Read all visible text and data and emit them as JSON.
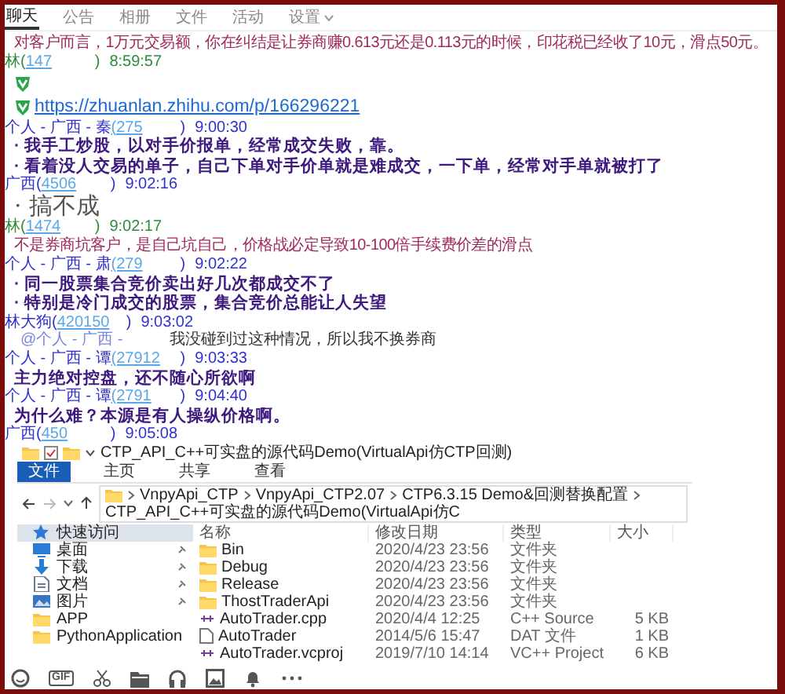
{
  "tabs": [
    {
      "label": "聊天",
      "selected": true,
      "dropdown": false
    },
    {
      "label": "公告",
      "selected": false,
      "dropdown": false
    },
    {
      "label": "相册",
      "selected": false,
      "dropdown": false
    },
    {
      "label": "文件",
      "selected": false,
      "dropdown": false
    },
    {
      "label": "活动",
      "selected": false,
      "dropdown": false
    },
    {
      "label": "设置",
      "selected": false,
      "dropdown": true
    }
  ],
  "messages": [
    {
      "kind": "quote",
      "text": "对客户而言，1万元交易额，你在纠结是让券商赚0.613元还是0.113元的时候，印花税已经收了10元，滑点50元。"
    },
    {
      "kind": "sender",
      "prefix": "林(",
      "id": "147",
      "suffix": ")",
      "time": "8:59:57",
      "color": "#2e8b3a"
    },
    {
      "kind": "badge"
    },
    {
      "kind": "link",
      "url": "https://zhuanlan.zhihu.com/p/166296221"
    },
    {
      "kind": "sender",
      "prefix": "个人 - 广西 - 秦",
      "id": "(275",
      "suffix": ")",
      "time": "9:00:30",
      "color": "#3030d0"
    },
    {
      "kind": "text",
      "text": "· 我手工炒股，以对手价报单，经常成交失败，靠。"
    },
    {
      "kind": "text",
      "text": "· 看着没人交易的单子，自己下单对手价单就是难成交，一下单，经常对手单就被打了"
    },
    {
      "kind": "sender",
      "prefix": "广西(",
      "id": "4506",
      "suffix": ")",
      "time": "9:02:16",
      "color": "#3030d0"
    },
    {
      "kind": "sticker",
      "text": "· 搞不成"
    },
    {
      "kind": "sender",
      "prefix": "林(",
      "id": "1474",
      "suffix": ")",
      "time": "9:02:17",
      "color": "#2e8b3a"
    },
    {
      "kind": "quote",
      "text": "不是券商坑客户，是自己坑自己，价格战必定导致10-100倍手续费价差的滑点"
    },
    {
      "kind": "sender",
      "prefix": "个人 - 广西 - 肃",
      "id": "(279",
      "suffix": ")",
      "time": "9:02:22",
      "color": "#3030d0"
    },
    {
      "kind": "text",
      "text": "· 同一股票集合竞价卖出好几次都成交不了"
    },
    {
      "kind": "text",
      "text": "· 特别是冷门成交的股票，集合竞价总能让人失望"
    },
    {
      "kind": "sender",
      "prefix": "林大狗(",
      "id": "420150",
      "suffix": ")",
      "time": "9:03:02",
      "color": "#3030d0"
    },
    {
      "kind": "mention",
      "mention": "@个人 - 广西 -",
      "text": "我没碰到过这种情况，所以我不换券商"
    },
    {
      "kind": "sender",
      "prefix": "个人 - 广西 - 谭",
      "id": "(27912",
      "suffix": ")",
      "time": "9:03:33",
      "color": "#3030d0"
    },
    {
      "kind": "text",
      "text": "主力绝对控盘，还不随心所欲啊"
    },
    {
      "kind": "sender",
      "prefix": "个人 - 广西 - 谭",
      "id": "(2791",
      "suffix": ")",
      "time": "9:04:40",
      "color": "#3030d0"
    },
    {
      "kind": "text",
      "text": "为什么难？本源是有人操纵价格啊。"
    },
    {
      "kind": "sender",
      "prefix": "广西(",
      "id": "450",
      "suffix": ")",
      "time": "9:05:08",
      "color": "#3030d0"
    }
  ],
  "explorer": {
    "title": "CTP_API_C++可实盘的源代码Demo(VirtualApi仿CTP回测)",
    "ribbon": [
      {
        "label": "文件",
        "selected": true
      },
      {
        "label": "主页",
        "selected": false
      },
      {
        "label": "共享",
        "selected": false
      },
      {
        "label": "查看",
        "selected": false
      }
    ],
    "path": [
      "VnpyApi_CTP",
      "VnpyApi_CTP2.07",
      "CTP6.3.15 Demo&回测替换配置",
      "CTP_API_C++可实盘的源代码Demo(VirtualApi仿C"
    ],
    "columns": [
      "名称",
      "修改日期",
      "类型",
      "大小"
    ],
    "nav": [
      {
        "label": "快速访问",
        "selected": true,
        "pinned": false
      },
      {
        "label": "桌面",
        "selected": false,
        "pinned": true
      },
      {
        "label": "下载",
        "selected": false,
        "pinned": true
      },
      {
        "label": "文档",
        "selected": false,
        "pinned": true
      },
      {
        "label": "图片",
        "selected": false,
        "pinned": true
      },
      {
        "label": "APP",
        "selected": false,
        "pinned": false
      },
      {
        "label": "PythonApplication",
        "selected": false,
        "pinned": false
      }
    ],
    "files": [
      {
        "kind": "folder",
        "name": "Bin",
        "date": "2020/4/23 23:56",
        "type": "文件夹"
      },
      {
        "kind": "folder",
        "name": "Debug",
        "date": "2020/4/23 23:56",
        "type": "文件夹"
      },
      {
        "kind": "folder",
        "name": "Release",
        "date": "2020/4/23 23:56",
        "type": "文件夹"
      },
      {
        "kind": "folder",
        "name": "ThostTraderApi",
        "date": "2020/4/23 23:56",
        "type": "文件夹"
      },
      {
        "kind": "code",
        "name": "AutoTrader.cpp",
        "date": "2020/4/4 12:25",
        "type": "C++ Source",
        "size": "5 KB"
      },
      {
        "kind": "file",
        "name": "AutoTrader",
        "date": "2014/5/6 15:47",
        "type": "DAT 文件",
        "size": "1 KB"
      },
      {
        "kind": "code",
        "name": "AutoTrader.vcproj",
        "date": "2019/7/10 14:14",
        "type": "VC++ Project",
        "size": "6 KB"
      }
    ]
  },
  "toolbar": {
    "gif": "GIF"
  }
}
